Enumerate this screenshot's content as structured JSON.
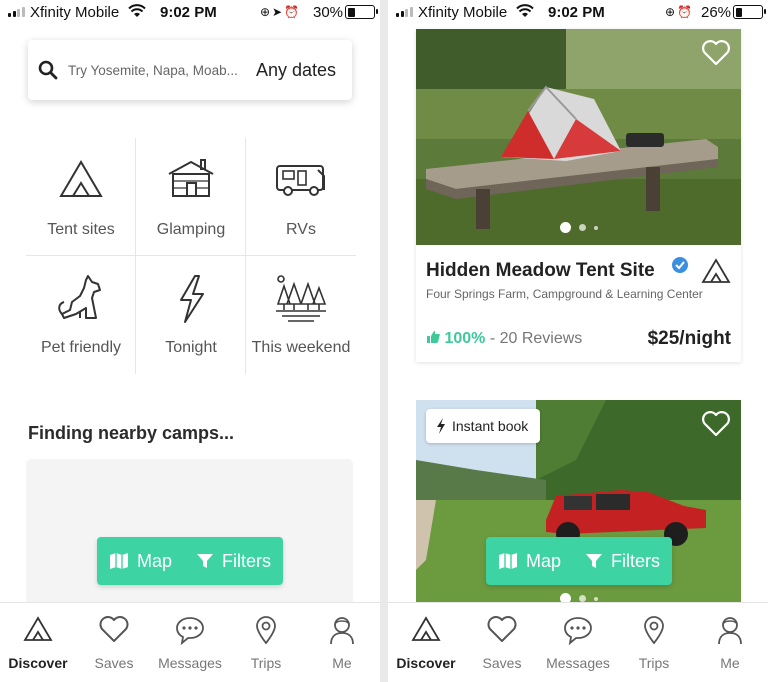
{
  "left": {
    "status": {
      "carrier": "Xfinity Mobile",
      "time": "9:02 PM",
      "battery": "30%",
      "battery_level": 0.3
    },
    "search": {
      "placeholder": "Try Yosemite, Napa, Moab...",
      "dates": "Any dates"
    },
    "categories": [
      {
        "label": "Tent sites",
        "icon": "tent-icon"
      },
      {
        "label": "Glamping",
        "icon": "cabin-icon"
      },
      {
        "label": "RVs",
        "icon": "rv-icon"
      },
      {
        "label": "Pet friendly",
        "icon": "dog-icon"
      },
      {
        "label": "Tonight",
        "icon": "lightning-icon"
      },
      {
        "label": "This weekend",
        "icon": "forest-icon"
      }
    ],
    "finding": "Finding nearby camps...",
    "map_label": "Map",
    "filters_label": "Filters"
  },
  "right": {
    "status": {
      "carrier": "Xfinity Mobile",
      "time": "9:02 PM",
      "battery": "26%",
      "battery_level": 0.26
    },
    "listing": {
      "title": "Hidden Meadow Tent Site",
      "subtitle": "Four Springs Farm, Campground & Learning Center",
      "rating_pct": "100%",
      "reviews": "- 20 Reviews",
      "price": "$25/night"
    },
    "instant_book": "Instant book",
    "map_label": "Map",
    "filters_label": "Filters"
  },
  "nav": [
    {
      "label": "Discover",
      "icon": "tent-icon"
    },
    {
      "label": "Saves",
      "icon": "heart-icon"
    },
    {
      "label": "Messages",
      "icon": "chat-icon"
    },
    {
      "label": "Trips",
      "icon": "pin-icon"
    },
    {
      "label": "Me",
      "icon": "person-icon"
    }
  ],
  "colors": {
    "accent": "#3ed3a2",
    "verified": "#3b8fe0"
  }
}
